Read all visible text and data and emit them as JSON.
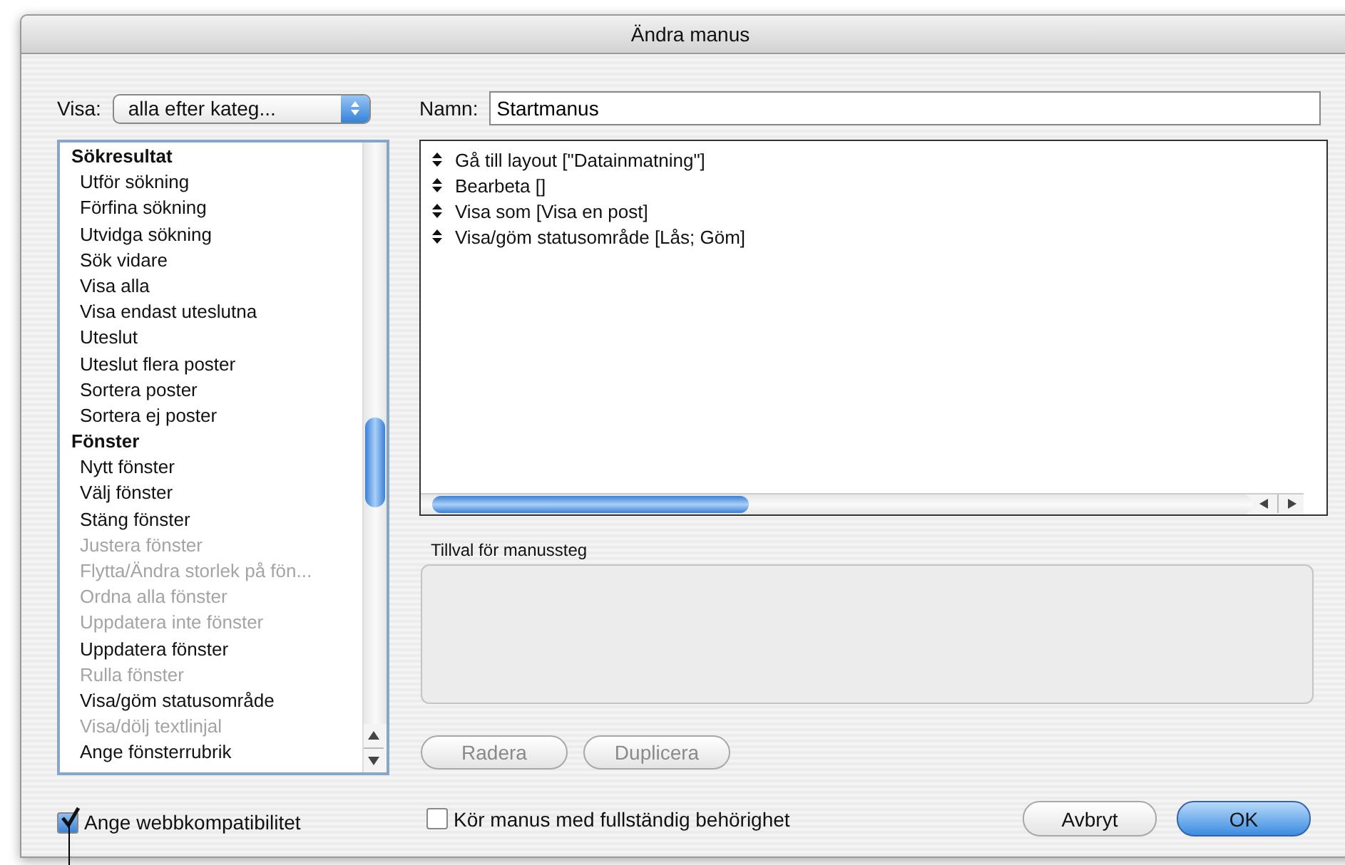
{
  "window": {
    "title": "Ändra manus"
  },
  "view_menu": {
    "label": "Visa:",
    "value": "alla efter kateg..."
  },
  "name_field": {
    "label": "Namn:",
    "value": "Startmanus"
  },
  "step_list": [
    {
      "kind": "category",
      "label": "Sökresultat"
    },
    {
      "kind": "step",
      "label": "Utför sökning",
      "disabled": false
    },
    {
      "kind": "step",
      "label": "Förfina sökning",
      "disabled": false
    },
    {
      "kind": "step",
      "label": "Utvidga sökning",
      "disabled": false
    },
    {
      "kind": "step",
      "label": "Sök vidare",
      "disabled": false
    },
    {
      "kind": "step",
      "label": "Visa alla",
      "disabled": false
    },
    {
      "kind": "step",
      "label": "Visa endast uteslutna",
      "disabled": false
    },
    {
      "kind": "step",
      "label": "Uteslut",
      "disabled": false
    },
    {
      "kind": "step",
      "label": "Uteslut flera poster",
      "disabled": false
    },
    {
      "kind": "step",
      "label": "Sortera poster",
      "disabled": false
    },
    {
      "kind": "step",
      "label": "Sortera ej poster",
      "disabled": false
    },
    {
      "kind": "category",
      "label": "Fönster"
    },
    {
      "kind": "step",
      "label": "Nytt fönster",
      "disabled": false
    },
    {
      "kind": "step",
      "label": "Välj fönster",
      "disabled": false
    },
    {
      "kind": "step",
      "label": "Stäng fönster",
      "disabled": false
    },
    {
      "kind": "step",
      "label": "Justera fönster",
      "disabled": true
    },
    {
      "kind": "step",
      "label": "Flytta/Ändra storlek på fön...",
      "disabled": true
    },
    {
      "kind": "step",
      "label": "Ordna alla fönster",
      "disabled": true
    },
    {
      "kind": "step",
      "label": "Uppdatera inte fönster",
      "disabled": true
    },
    {
      "kind": "step",
      "label": "Uppdatera fönster",
      "disabled": false
    },
    {
      "kind": "step",
      "label": "Rulla fönster",
      "disabled": true
    },
    {
      "kind": "step",
      "label": "Visa/göm statusområde",
      "disabled": false
    },
    {
      "kind": "step",
      "label": "Visa/dölj textlinjal",
      "disabled": true
    },
    {
      "kind": "step",
      "label": "Ange fönsterrubrik",
      "disabled": false
    }
  ],
  "script_steps": [
    {
      "text": "Gå till layout [\"Datainmatning\"]"
    },
    {
      "text": "Bearbeta []"
    },
    {
      "text": "Visa som [Visa en post]"
    },
    {
      "text": "Visa/göm statusområde [Lås; Göm]"
    }
  ],
  "options": {
    "title": "Tillval för manussteg"
  },
  "edit_buttons": [
    {
      "label": "Radera",
      "disabled": true
    },
    {
      "label": "Duplicera",
      "disabled": true
    }
  ],
  "web_compatibility": {
    "label": "Ange webbkompatibilitet",
    "checked": true
  },
  "full_access": {
    "label": "Kör manus med fullständig behörighet",
    "checked": false
  },
  "buttons": [
    {
      "label": "Avbryt",
      "default": false
    },
    {
      "label": "OK",
      "default": true
    }
  ]
}
